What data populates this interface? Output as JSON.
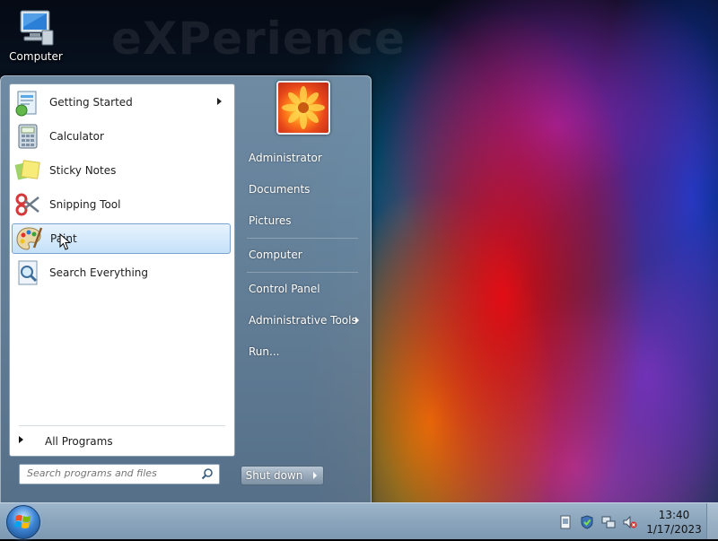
{
  "desktop": {
    "watermark": "eXPerience",
    "icons": [
      {
        "label": "Computer",
        "icon": "computer-icon"
      }
    ]
  },
  "start_menu": {
    "programs": [
      {
        "label": "Getting Started",
        "icon": "getting-started-icon",
        "has_submenu": true
      },
      {
        "label": "Calculator",
        "icon": "calculator-icon"
      },
      {
        "label": "Sticky Notes",
        "icon": "sticky-notes-icon"
      },
      {
        "label": "Snipping Tool",
        "icon": "scissors-icon"
      },
      {
        "label": "Paint",
        "icon": "paint-palette-icon",
        "highlighted": true
      },
      {
        "label": "Search Everything",
        "icon": "magnifier-icon"
      }
    ],
    "all_programs": "All Programs",
    "search_placeholder": "Search programs and files",
    "right_items": [
      {
        "label": "Administrator"
      },
      {
        "label": "Documents"
      },
      {
        "label": "Pictures"
      },
      {
        "label": "Computer"
      },
      {
        "label": "Control Panel"
      },
      {
        "label": "Administrative Tools",
        "has_submenu": true
      },
      {
        "label": "Run..."
      }
    ],
    "shutdown_label": "Shut down"
  },
  "taskbar": {
    "tray_icons": [
      "action-center-icon",
      "security-shield-icon",
      "network-icon",
      "volume-muted-icon"
    ],
    "clock": {
      "time": "13:40",
      "date": "1/17/2023"
    }
  },
  "colors": {
    "highlight": "#c4e1f8",
    "taskbar": "#8aa5bc",
    "menu_frame": "#7891a8"
  }
}
